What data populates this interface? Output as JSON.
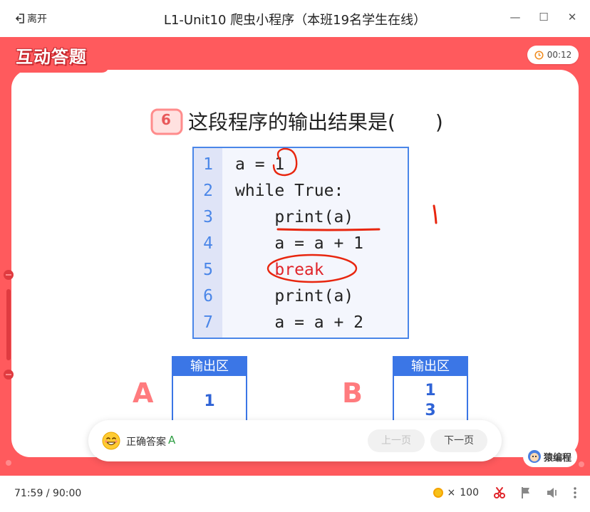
{
  "titlebar": {
    "leave_label": "离开",
    "title": "L1-Unit10 爬虫小程序（本班19名学生在线）",
    "minimize_glyph": "—",
    "maximize_glyph": "☐",
    "close_glyph": "✕"
  },
  "stage": {
    "badge": "互动答题",
    "timer": "00:12",
    "accent_color": "#ff5a5d"
  },
  "question": {
    "number": "6",
    "text": "这段程序的输出结果是(　　)"
  },
  "code": {
    "line_numbers": [
      "1",
      "2",
      "3",
      "4",
      "5",
      "6",
      "7"
    ],
    "lines": [
      "a = 1",
      "while True:",
      "    print(a)",
      "    a = a + 1",
      "    break",
      "    print(a)",
      "    a = a + 2"
    ]
  },
  "options": [
    {
      "letter": "A",
      "header": "输出区",
      "values": [
        "1"
      ]
    },
    {
      "letter": "B",
      "header": "输出区",
      "values": [
        "1",
        "3"
      ]
    }
  ],
  "answer": {
    "label": "正确答案",
    "value": "A",
    "prev_label": "上一页",
    "next_label": "下一页"
  },
  "brand": "猿编程",
  "bottom": {
    "time": "71:59 / 90:00",
    "coins_prefix": "×",
    "coins": "100"
  }
}
